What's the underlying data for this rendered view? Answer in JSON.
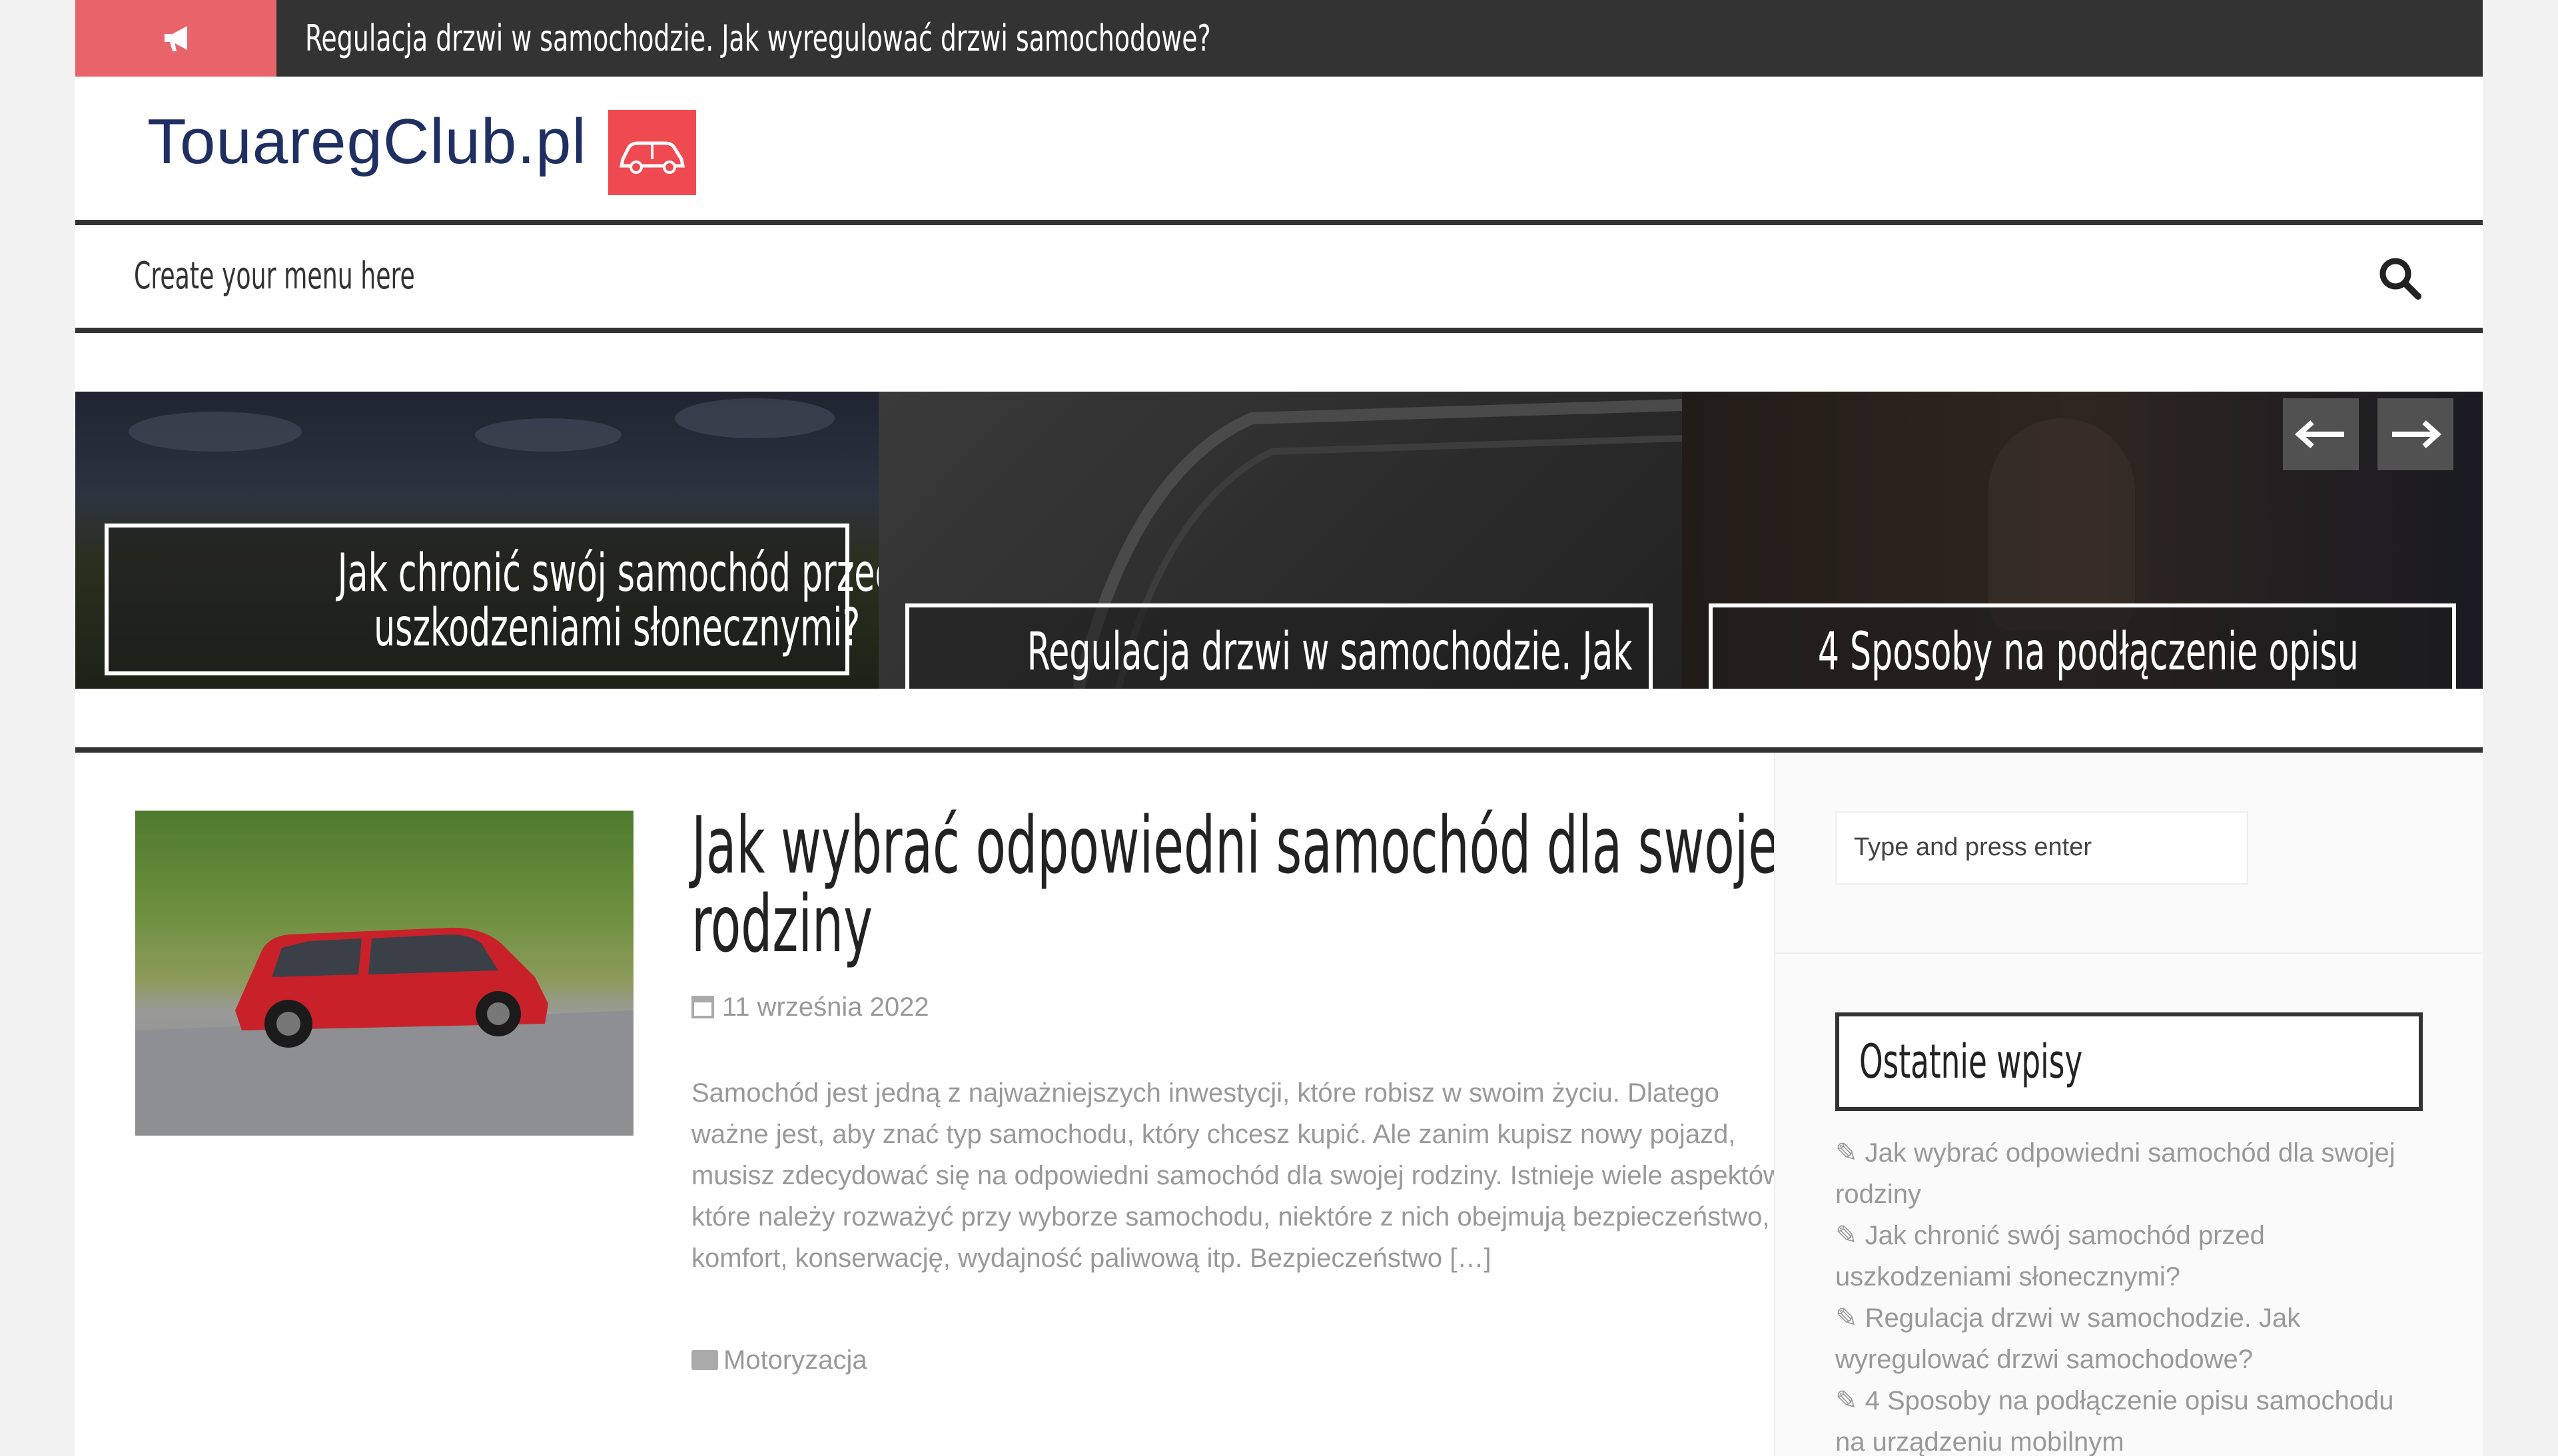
{
  "ticker": {
    "icon": "megaphone-icon",
    "text": "Regulacja drzwi w samochodzie. Jak wyregulować drzwi samochodowe?"
  },
  "logo": {
    "text": "TouaregClub.pl",
    "icon": "car-icon"
  },
  "nav": {
    "text": "Create your menu here",
    "search_icon": "search-icon"
  },
  "slider": {
    "slides": [
      {
        "caption": "Jak chronić swój samochód przed uszkodzeniami słonecznymi?"
      },
      {
        "caption": "Regulacja drzwi w samochodzie. Jak"
      },
      {
        "caption": "4 Sposoby na podłączenie opisu"
      }
    ],
    "prev_icon": "arrow-left-icon",
    "next_icon": "arrow-right-icon"
  },
  "post": {
    "title": "Jak wybrać odpowiedni samochód dla swojej rodziny",
    "date": "11 września 2022",
    "excerpt": "Samochód jest jedną z najważniejszych inwestycji, które robisz w swoim życiu. Dlatego ważne jest, aby znać typ samochodu, który chcesz kupić. Ale zanim kupisz nowy pojazd, musisz zdecydować się na odpowiedni samochód dla swojej rodziny. Istnieje wiele aspektów, które należy rozważyć przy wyborze samochodu, niektóre z nich obejmują bezpieczeństwo, komfort, konserwację, wydajność paliwową itp. Bezpieczeństwo […]",
    "category": "Motoryzacja"
  },
  "sidebar": {
    "search_placeholder": "Type and press enter",
    "widget_title": "Ostatnie wpisy",
    "recent": [
      "Jak wybrać odpowiedni samochód dla swojej rodziny",
      "Jak chronić swój samochód przed uszkodzeniami słonecznymi?",
      "Regulacja drzwi w samochodzie. Jak wyregulować drzwi samochodowe?",
      "4 Sposoby na podłączenie opisu samochodu na urządzeniu mobilnym"
    ]
  },
  "colors": {
    "accent": "#ef4a52",
    "ticker_bg": "#333333",
    "logo_text": "#1f2f62"
  }
}
